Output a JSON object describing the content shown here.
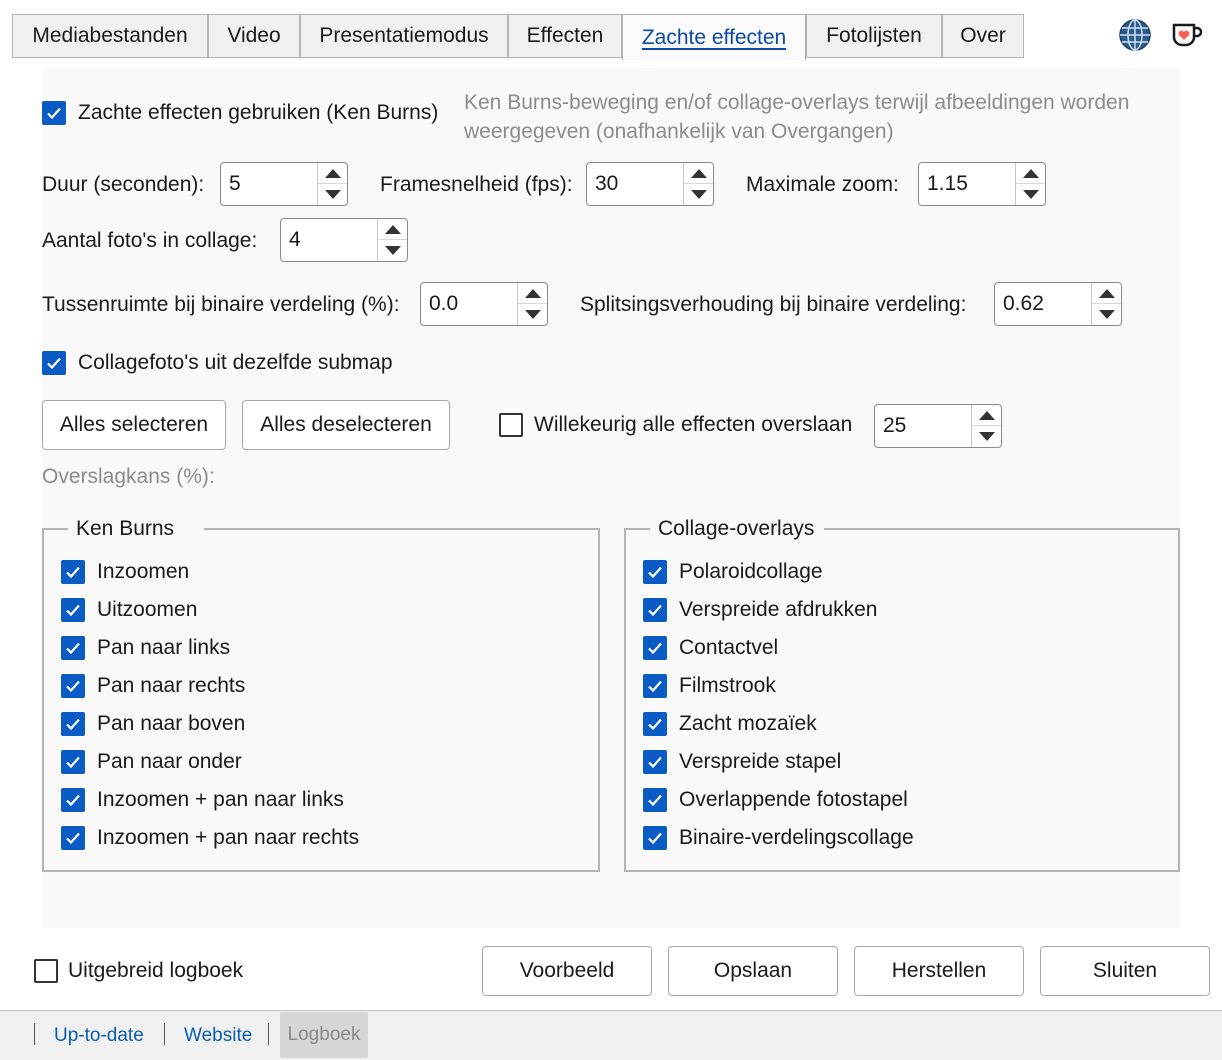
{
  "tabs": [
    {
      "label": "Mediabestanden"
    },
    {
      "label": "Video"
    },
    {
      "label": "Presentatiemodus"
    },
    {
      "label": "Effecten"
    },
    {
      "label": "Zachte effecten",
      "active": true
    },
    {
      "label": "Fotolijsten"
    },
    {
      "label": "Over"
    }
  ],
  "settings": {
    "enable_label": "Zachte effecten gebruiken (Ken Burns)",
    "enable_checked": true,
    "enable_hint": "Ken Burns-beweging en/of collage-overlays terwijl afbeeldingen worden weergegeven (onafhankelijk van Overgangen)",
    "duration_label": "Duur (seconden):",
    "duration_value": "5",
    "fps_label": "Framesnelheid (fps):",
    "fps_value": "30",
    "zoom_label": "Maximale zoom:",
    "zoom_value": "1.15",
    "collage_count_label": "Aantal foto's in collage:",
    "collage_count_value": "4",
    "gap_label": "Tussenruimte bij binaire verdeling (%):",
    "gap_value": "0.0",
    "ratio_label": "Splitsingsverhouding bij binaire verdeling:",
    "ratio_value": "0.62",
    "same_folder_label": "Collagefoto's uit dezelfde submap",
    "same_folder_checked": true,
    "select_all": "Alles selecteren",
    "deselect_all": "Alles deselecteren",
    "random_skip_label": "Willekeurig alle effecten overslaan",
    "random_skip_checked": false,
    "random_skip_value": "25",
    "skip_chance_label": "Overslagkans (%):"
  },
  "ken_burns": {
    "title": "Ken Burns",
    "items": [
      {
        "label": "Inzoomen",
        "checked": true
      },
      {
        "label": "Uitzoomen",
        "checked": true
      },
      {
        "label": "Pan naar links",
        "checked": true
      },
      {
        "label": "Pan naar rechts",
        "checked": true
      },
      {
        "label": "Pan naar boven",
        "checked": true
      },
      {
        "label": "Pan naar onder",
        "checked": true
      },
      {
        "label": "Inzoomen + pan naar links",
        "checked": true
      },
      {
        "label": "Inzoomen + pan naar rechts",
        "checked": true
      }
    ]
  },
  "collage": {
    "title": "Collage-overlays",
    "items": [
      {
        "label": "Polaroidcollage",
        "checked": true
      },
      {
        "label": "Verspreide afdrukken",
        "checked": true
      },
      {
        "label": "Contactvel",
        "checked": true
      },
      {
        "label": "Filmstrook",
        "checked": true
      },
      {
        "label": "Zacht mozaïek",
        "checked": true
      },
      {
        "label": "Verspreide stapel",
        "checked": true
      },
      {
        "label": "Overlappende fotostapel",
        "checked": true
      },
      {
        "label": "Binaire-verdelingscollage",
        "checked": true
      }
    ]
  },
  "footer": {
    "verbose_log_label": "Uitgebreid logboek",
    "verbose_log_checked": false,
    "preview": "Voorbeeld",
    "save": "Opslaan",
    "reset": "Herstellen",
    "close": "Sluiten"
  },
  "statusbar": {
    "uptodate": "Up-to-date",
    "website": "Website",
    "log": "Logboek"
  },
  "icons": {
    "language": "globe-icon",
    "donate": "coffee-heart-icon"
  },
  "colors": {
    "accent": "#0a5bc4",
    "link": "#0b5cad",
    "hint": "#8c8c8c"
  }
}
